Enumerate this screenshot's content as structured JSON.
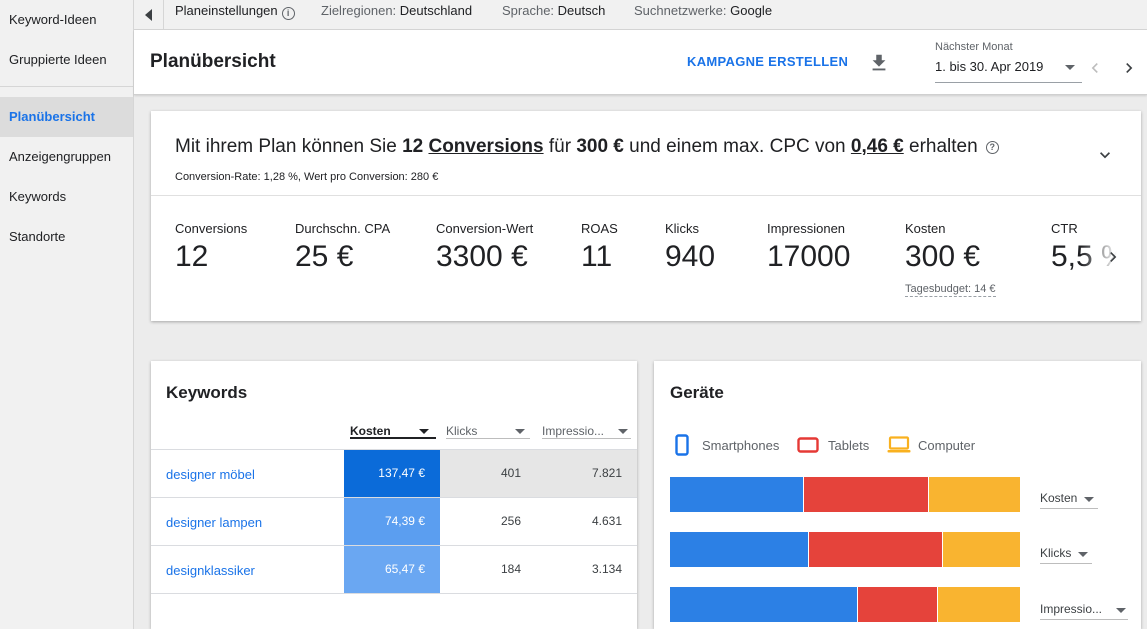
{
  "sidebar": {
    "items": [
      {
        "label": "Keyword-Ideen",
        "active": false
      },
      {
        "label": "Gruppierte Ideen",
        "active": false
      },
      {
        "label": "Planübersicht",
        "active": true
      },
      {
        "label": "Anzeigengruppen",
        "active": false
      },
      {
        "label": "Keywords",
        "active": false
      },
      {
        "label": "Standorte",
        "active": false
      }
    ]
  },
  "topbar": {
    "plan_settings": "Planeinstellungen",
    "regions_label": "Zielregionen:",
    "regions_value": "Deutschland",
    "language_label": "Sprache:",
    "language_value": "Deutsch",
    "networks_label": "Suchnetzwerke:",
    "networks_value": "Google"
  },
  "header": {
    "title": "Planübersicht",
    "create_campaign": "KAMPAGNE ERSTELLEN",
    "date_label": "Nächster Monat",
    "date_value": "1. bis 30. Apr 2019"
  },
  "summary": {
    "headline": {
      "p1": "Mit ihrem Plan können Sie ",
      "conversions_count": "12",
      "conversions_word": "Conversions",
      "p2": " für ",
      "budget": "300 €",
      "p3": " und einem max. CPC von ",
      "cpc": "0,46 €",
      "p4": " erhalten"
    },
    "subline": "Conversion-Rate: 1,28 %, Wert pro Conversion: 280 €",
    "metrics": [
      {
        "label": "Conversions",
        "value": "12"
      },
      {
        "label": "Durchschn. CPA",
        "value": "25 €"
      },
      {
        "label": "Conversion-Wert",
        "value": "3300 €"
      },
      {
        "label": "ROAS",
        "value": "11"
      },
      {
        "label": "Klicks",
        "value": "940"
      },
      {
        "label": "Impressionen",
        "value": "17000"
      },
      {
        "label": "Kosten",
        "value": "300 €"
      },
      {
        "label": "CTR",
        "value": "5,5 %"
      }
    ],
    "daily_budget": "Tagesbudget: 14 €"
  },
  "keywords": {
    "title": "Keywords",
    "columns": [
      "Kosten",
      "Klicks",
      "Impressio..."
    ],
    "rows": [
      {
        "keyword": "designer möbel",
        "cost": "137,47 €",
        "clicks": "401",
        "impressions": "7.821",
        "cost_color": "#0b6bd9"
      },
      {
        "keyword": "designer lampen",
        "cost": "74,39 €",
        "clicks": "256",
        "impressions": "4.631",
        "cost_color": "#5b9ef0"
      },
      {
        "keyword": "designklassiker",
        "cost": "65,47 €",
        "clicks": "184",
        "impressions": "3.134",
        "cost_color": "#6aa7f2"
      }
    ]
  },
  "devices": {
    "title": "Geräte",
    "legend": [
      {
        "name": "Smartphones",
        "color": "#1a73e8",
        "icon": "smartphone-icon"
      },
      {
        "name": "Tablets",
        "color": "#e53935",
        "icon": "tablet-icon"
      },
      {
        "name": "Computer",
        "color": "#f9b11f",
        "icon": "computer-icon"
      }
    ],
    "rows": [
      {
        "metric": "Kosten",
        "shares": [
          0.384,
          0.357,
          0.259
        ]
      },
      {
        "metric": "Klicks",
        "shares": [
          0.396,
          0.384,
          0.22
        ]
      },
      {
        "metric": "Impressio...",
        "shares": [
          0.536,
          0.229,
          0.235
        ]
      }
    ],
    "colors": [
      "#2c80e5",
      "#e5433b",
      "#f9b430"
    ]
  }
}
